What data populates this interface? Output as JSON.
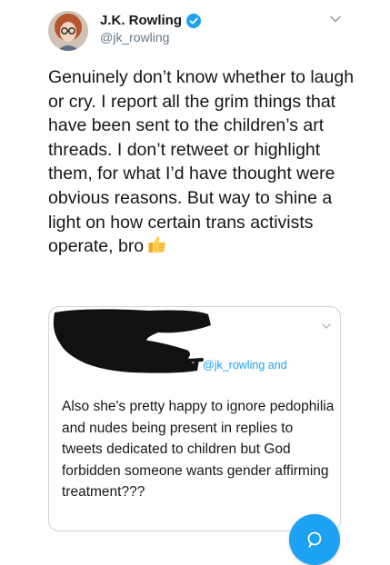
{
  "tweet": {
    "author_name": "J.K. Rowling",
    "handle": "@jk_rowling",
    "text": "Genuinely don’t know whether to laugh or cry. I report all the grim things that have been sent to the children’s art threads. I don’t retweet or highlight them, for what I’d have thought were obvious reasons. But way to shine a light on how certain trans activists operate, bro",
    "emoji_icon": "thumbs-up-icon"
  },
  "quoted_tweet": {
    "replying_to": "@jk_rowling and",
    "text": "Also she's pretty happy to ignore pedophilia and nudes being present in replies to tweets dedicated to children but God forbidden someone wants gender affirming treatment???"
  },
  "colors": {
    "accent": "#1da1f2",
    "text": "#14171a",
    "secondary_text": "#657786",
    "border": "#ccd6dd"
  }
}
